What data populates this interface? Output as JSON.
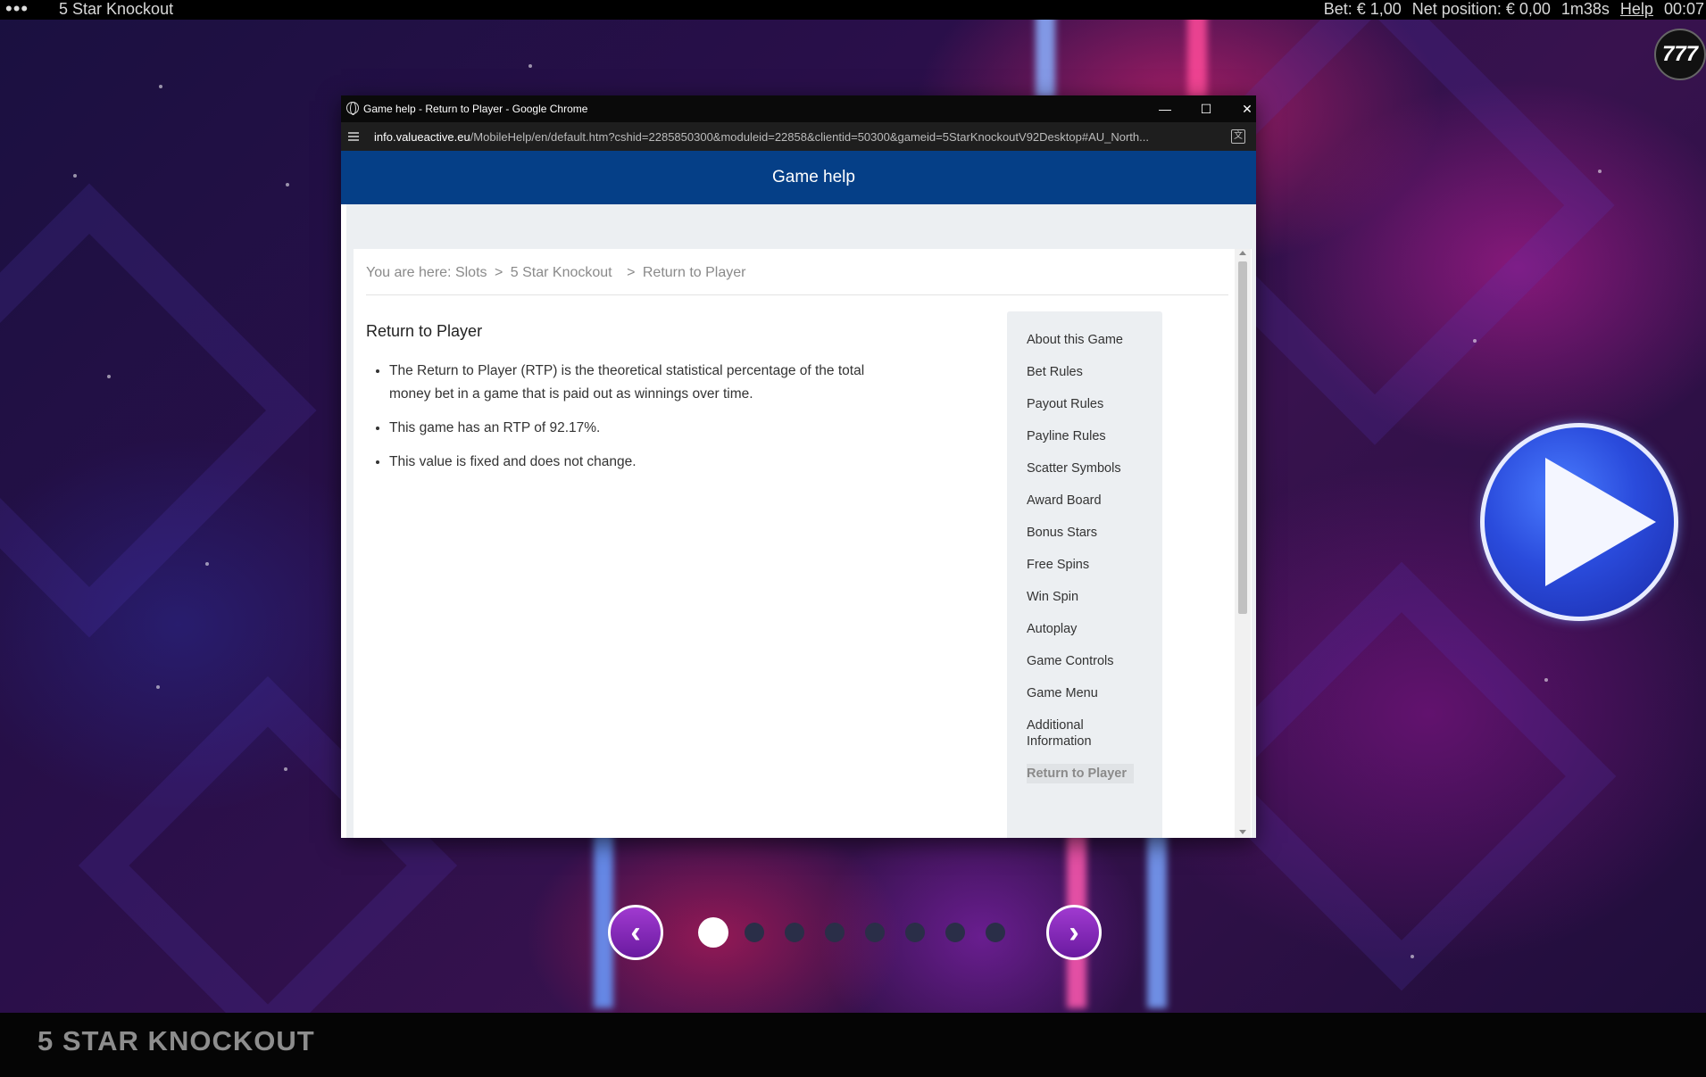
{
  "topbar": {
    "menu_icon": "•••",
    "game_title": "5 Star Knockout",
    "bet": "Bet: € 1,00",
    "net_position": "Net position: € 0,00",
    "session_time": "1m38s",
    "help_label": "Help",
    "clock": "00:07"
  },
  "logo_text": "777",
  "popup": {
    "window_title": "Game help - Return to Player - Google Chrome",
    "url_host": "info.valueactive.eu",
    "url_path": "/MobileHelp/en/default.htm?cshid=2285850300&moduleid=22858&clientid=50300&gameid=5StarKnockoutV92Desktop#AU_North...",
    "header": "Game help",
    "breadcrumb": {
      "prefix": "You are here:",
      "items": [
        "Slots",
        "5 Star Knockout",
        "Return to Player"
      ],
      "separator": ">"
    },
    "heading": "Return to Player",
    "bullets": [
      "The Return to Player (RTP) is the theoretical statistical percentage of the total money bet in a game that is paid out as winnings over time.",
      "This game has an RTP of 92.17%.",
      "This value is fixed and does not change."
    ],
    "menu_items": [
      "About this Game",
      "Bet Rules",
      "Payout Rules",
      "Payline Rules",
      "Scatter Symbols",
      "Award Board",
      "Bonus Stars",
      "Free Spins",
      "Win Spin",
      "Autoplay",
      "Game Controls",
      "Game Menu",
      "Additional Information",
      "Return to Player"
    ],
    "active_menu_item": "Return to Player"
  },
  "carousel": {
    "prev_icon": "‹",
    "next_icon": "›",
    "page_count": 8,
    "active_page": 1
  },
  "bottombar": {
    "brand": "5 STAR KNOCKOUT"
  },
  "colors": {
    "help_header": "#053f87",
    "play_button": "#2a4bdc",
    "nav_arrow": "#8a2ac0"
  }
}
